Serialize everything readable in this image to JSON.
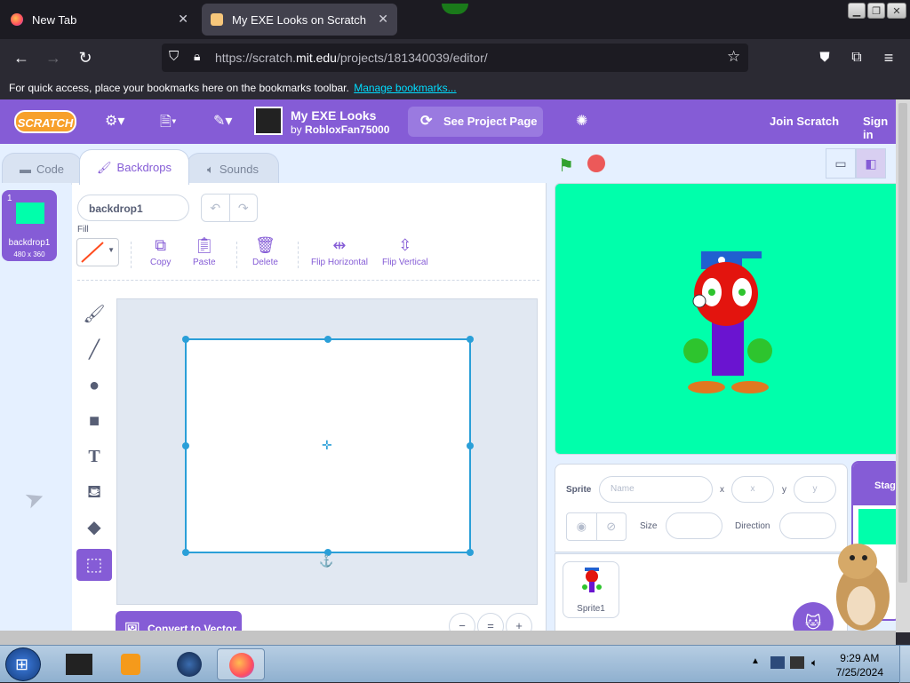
{
  "browser": {
    "tabs": [
      {
        "title": "New Tab"
      },
      {
        "title": "My EXE Looks on Scratch"
      }
    ],
    "url_prefix": "https://scratch.",
    "url_domain": "mit.edu",
    "url_path": "/projects/181340039/editor/",
    "bookmarks_bar_text": "For quick access, place your bookmarks here on the bookmarks toolbar.",
    "manage_bookmarks_link": "Manage bookmarks..."
  },
  "scratch_header": {
    "logo_text": "SCRATCH",
    "project_title": "My EXE Looks",
    "by_label": "by",
    "author": "RobloxFan75000",
    "see_project_page": "See Project Page",
    "join": "Join Scratch",
    "sign_in": "Sign in"
  },
  "editor_tabs": {
    "code": "Code",
    "backdrops": "Backdrops",
    "sounds": "Sounds"
  },
  "costume_list": [
    {
      "number": "1",
      "name": "backdrop1",
      "size": "480 x 360",
      "thumb_color": "#00ffab"
    }
  ],
  "paint_editor": {
    "costume_name": "backdrop1",
    "fill_label": "Fill",
    "actions": {
      "copy": "Copy",
      "paste": "Paste",
      "delete": "Delete",
      "flip_horizontal": "Flip Horizontal",
      "flip_vertical": "Flip Vertical"
    },
    "convert_button": "Convert to Vector",
    "zoom": {
      "out": "−",
      "reset": "=",
      "in": "+"
    }
  },
  "stage": {
    "background_color": "#00ffab"
  },
  "sprite_info": {
    "sprite_label": "Sprite",
    "name_placeholder": "Name",
    "x_label": "x",
    "x_placeholder": "x",
    "y_label": "y",
    "y_placeholder": "y",
    "size_label": "Size",
    "direction_label": "Direction"
  },
  "sprites": [
    {
      "name": "Sprite1"
    }
  ],
  "stage_pane": {
    "header": "Stage"
  },
  "taskbar": {
    "time": "9:29 AM",
    "date": "7/25/2024"
  },
  "colors": {
    "scratch_purple": "#855cd6",
    "stage_green": "#00ffab",
    "selection_blue": "#2a9fd8"
  }
}
